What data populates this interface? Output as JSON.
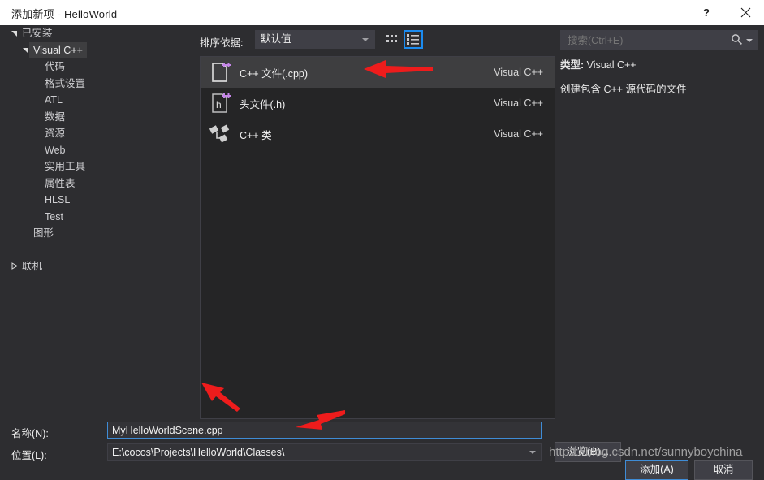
{
  "window": {
    "title": "添加新项 - HelloWorld",
    "help_label": "?",
    "close_label": "×",
    "accent_color": "#3f7fbf",
    "titlebar_bg": "#ffffff",
    "dialog_bg": "#2d2d30"
  },
  "tree": {
    "root_label": "已安装",
    "nodes": [
      {
        "label": "已安装",
        "level": 0,
        "expander": "expanded",
        "selected": false
      },
      {
        "label": "Visual C++",
        "level": 1,
        "expander": "expanded",
        "selected": true
      },
      {
        "label": "代码",
        "level": 2,
        "expander": "none",
        "selected": false
      },
      {
        "label": "格式设置",
        "level": 2,
        "expander": "none",
        "selected": false
      },
      {
        "label": "ATL",
        "level": 2,
        "expander": "none",
        "selected": false
      },
      {
        "label": "数据",
        "level": 2,
        "expander": "none",
        "selected": false
      },
      {
        "label": "资源",
        "level": 2,
        "expander": "none",
        "selected": false
      },
      {
        "label": "Web",
        "level": 2,
        "expander": "none",
        "selected": false
      },
      {
        "label": "实用工具",
        "level": 2,
        "expander": "none",
        "selected": false
      },
      {
        "label": "属性表",
        "level": 2,
        "expander": "none",
        "selected": false
      },
      {
        "label": "HLSL",
        "level": 2,
        "expander": "none",
        "selected": false
      },
      {
        "label": "Test",
        "level": 2,
        "expander": "none",
        "selected": false
      },
      {
        "label": "图形",
        "level": 1,
        "expander": "none",
        "selected": false
      },
      {
        "label": "",
        "level": 1,
        "expander": "none",
        "selected": false
      },
      {
        "label": "联机",
        "level": 0,
        "expander": "collapsed",
        "selected": false
      }
    ]
  },
  "center": {
    "sort_label": "排序依据:",
    "sort_value": "默认值",
    "view_grid_name": "tiles-view",
    "view_list_name": "list-view",
    "view_list_selected": true,
    "items": [
      {
        "name": "C++ 文件(.cpp)",
        "source": "Visual C++",
        "icon": "cpp-file-icon",
        "selected": true
      },
      {
        "name": "头文件(.h)",
        "source": "Visual C++",
        "icon": "header-file-icon",
        "selected": false
      },
      {
        "name": "C++ 类",
        "source": "Visual C++",
        "icon": "cpp-class-icon",
        "selected": false
      }
    ]
  },
  "right": {
    "search_placeholder": "搜索(Ctrl+E)",
    "search_value": "",
    "type_key": "类型:",
    "type_value": "Visual C++",
    "description": "创建包含 C++ 源代码的文件"
  },
  "form": {
    "name_label": "名称(N):",
    "name_value": "MyHelloWorldScene.cpp",
    "location_label": "位置(L):",
    "location_value": "E:\\cocos\\Projects\\HelloWorld\\Classes\\",
    "browse_label": "浏览(B)...",
    "add_label": "添加(A)",
    "cancel_label": "取消"
  },
  "overlay": {
    "watermark": "https://blog.csdn.net/sunnyboyc​hina",
    "arrow_color": "#ee1c1c",
    "annotations": [
      {
        "name": "arrow-to-cpp-file-item"
      },
      {
        "name": "arrow-to-name-field"
      },
      {
        "name": "arrow-to-location-field"
      }
    ]
  }
}
